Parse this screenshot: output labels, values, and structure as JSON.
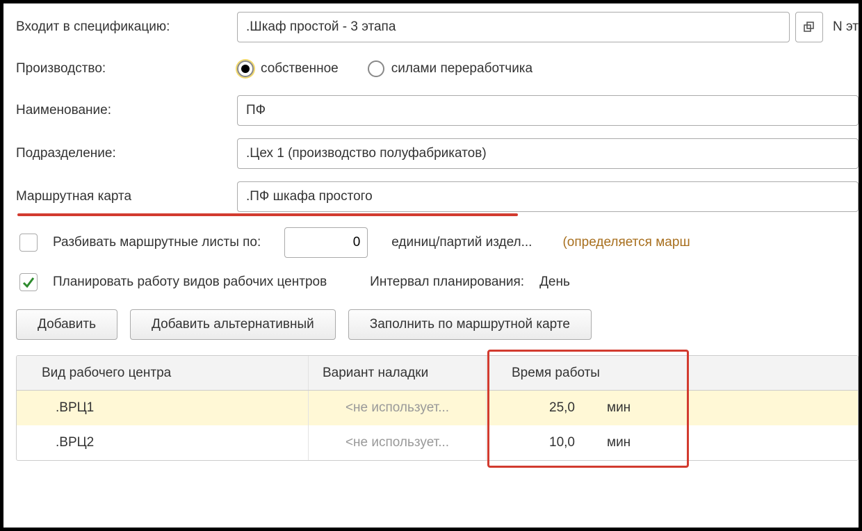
{
  "form": {
    "spec_label": "Входит в спецификацию:",
    "spec_value": ".Шкаф простой - 3 этапа",
    "n_etapa_label": "N эт",
    "prod_label": "Производство:",
    "prod_own": "собственное",
    "prod_ext": "силами переработчика",
    "name_label": "Наименование:",
    "name_value": "ПФ",
    "dept_label": "Подразделение:",
    "dept_value": ".Цех 1 (производство полуфабрикатов)",
    "route_label": "Маршрутная карта",
    "route_value": ".ПФ шкафа простого"
  },
  "options": {
    "split_label": "Разбивать маршрутные листы по:",
    "split_value": "0",
    "split_units": "единиц/партий издел...",
    "split_hint": "(определяется марш",
    "plan_label": "Планировать работу видов рабочих центров",
    "interval_label": "Интервал планирования:",
    "interval_value": "День"
  },
  "buttons": {
    "add": "Добавить",
    "add_alt": "Добавить альтернативный",
    "fill": "Заполнить по маршрутной карте"
  },
  "table": {
    "h1": "Вид рабочего центра",
    "h2": "Вариант наладки",
    "h3": "Время работы",
    "rows": [
      {
        "center": ".ВРЦ1",
        "setup": "<не использует...",
        "time": "25,0",
        "unit": "мин"
      },
      {
        "center": ".ВРЦ2",
        "setup": "<не использует...",
        "time": "10,0",
        "unit": "мин"
      }
    ]
  }
}
